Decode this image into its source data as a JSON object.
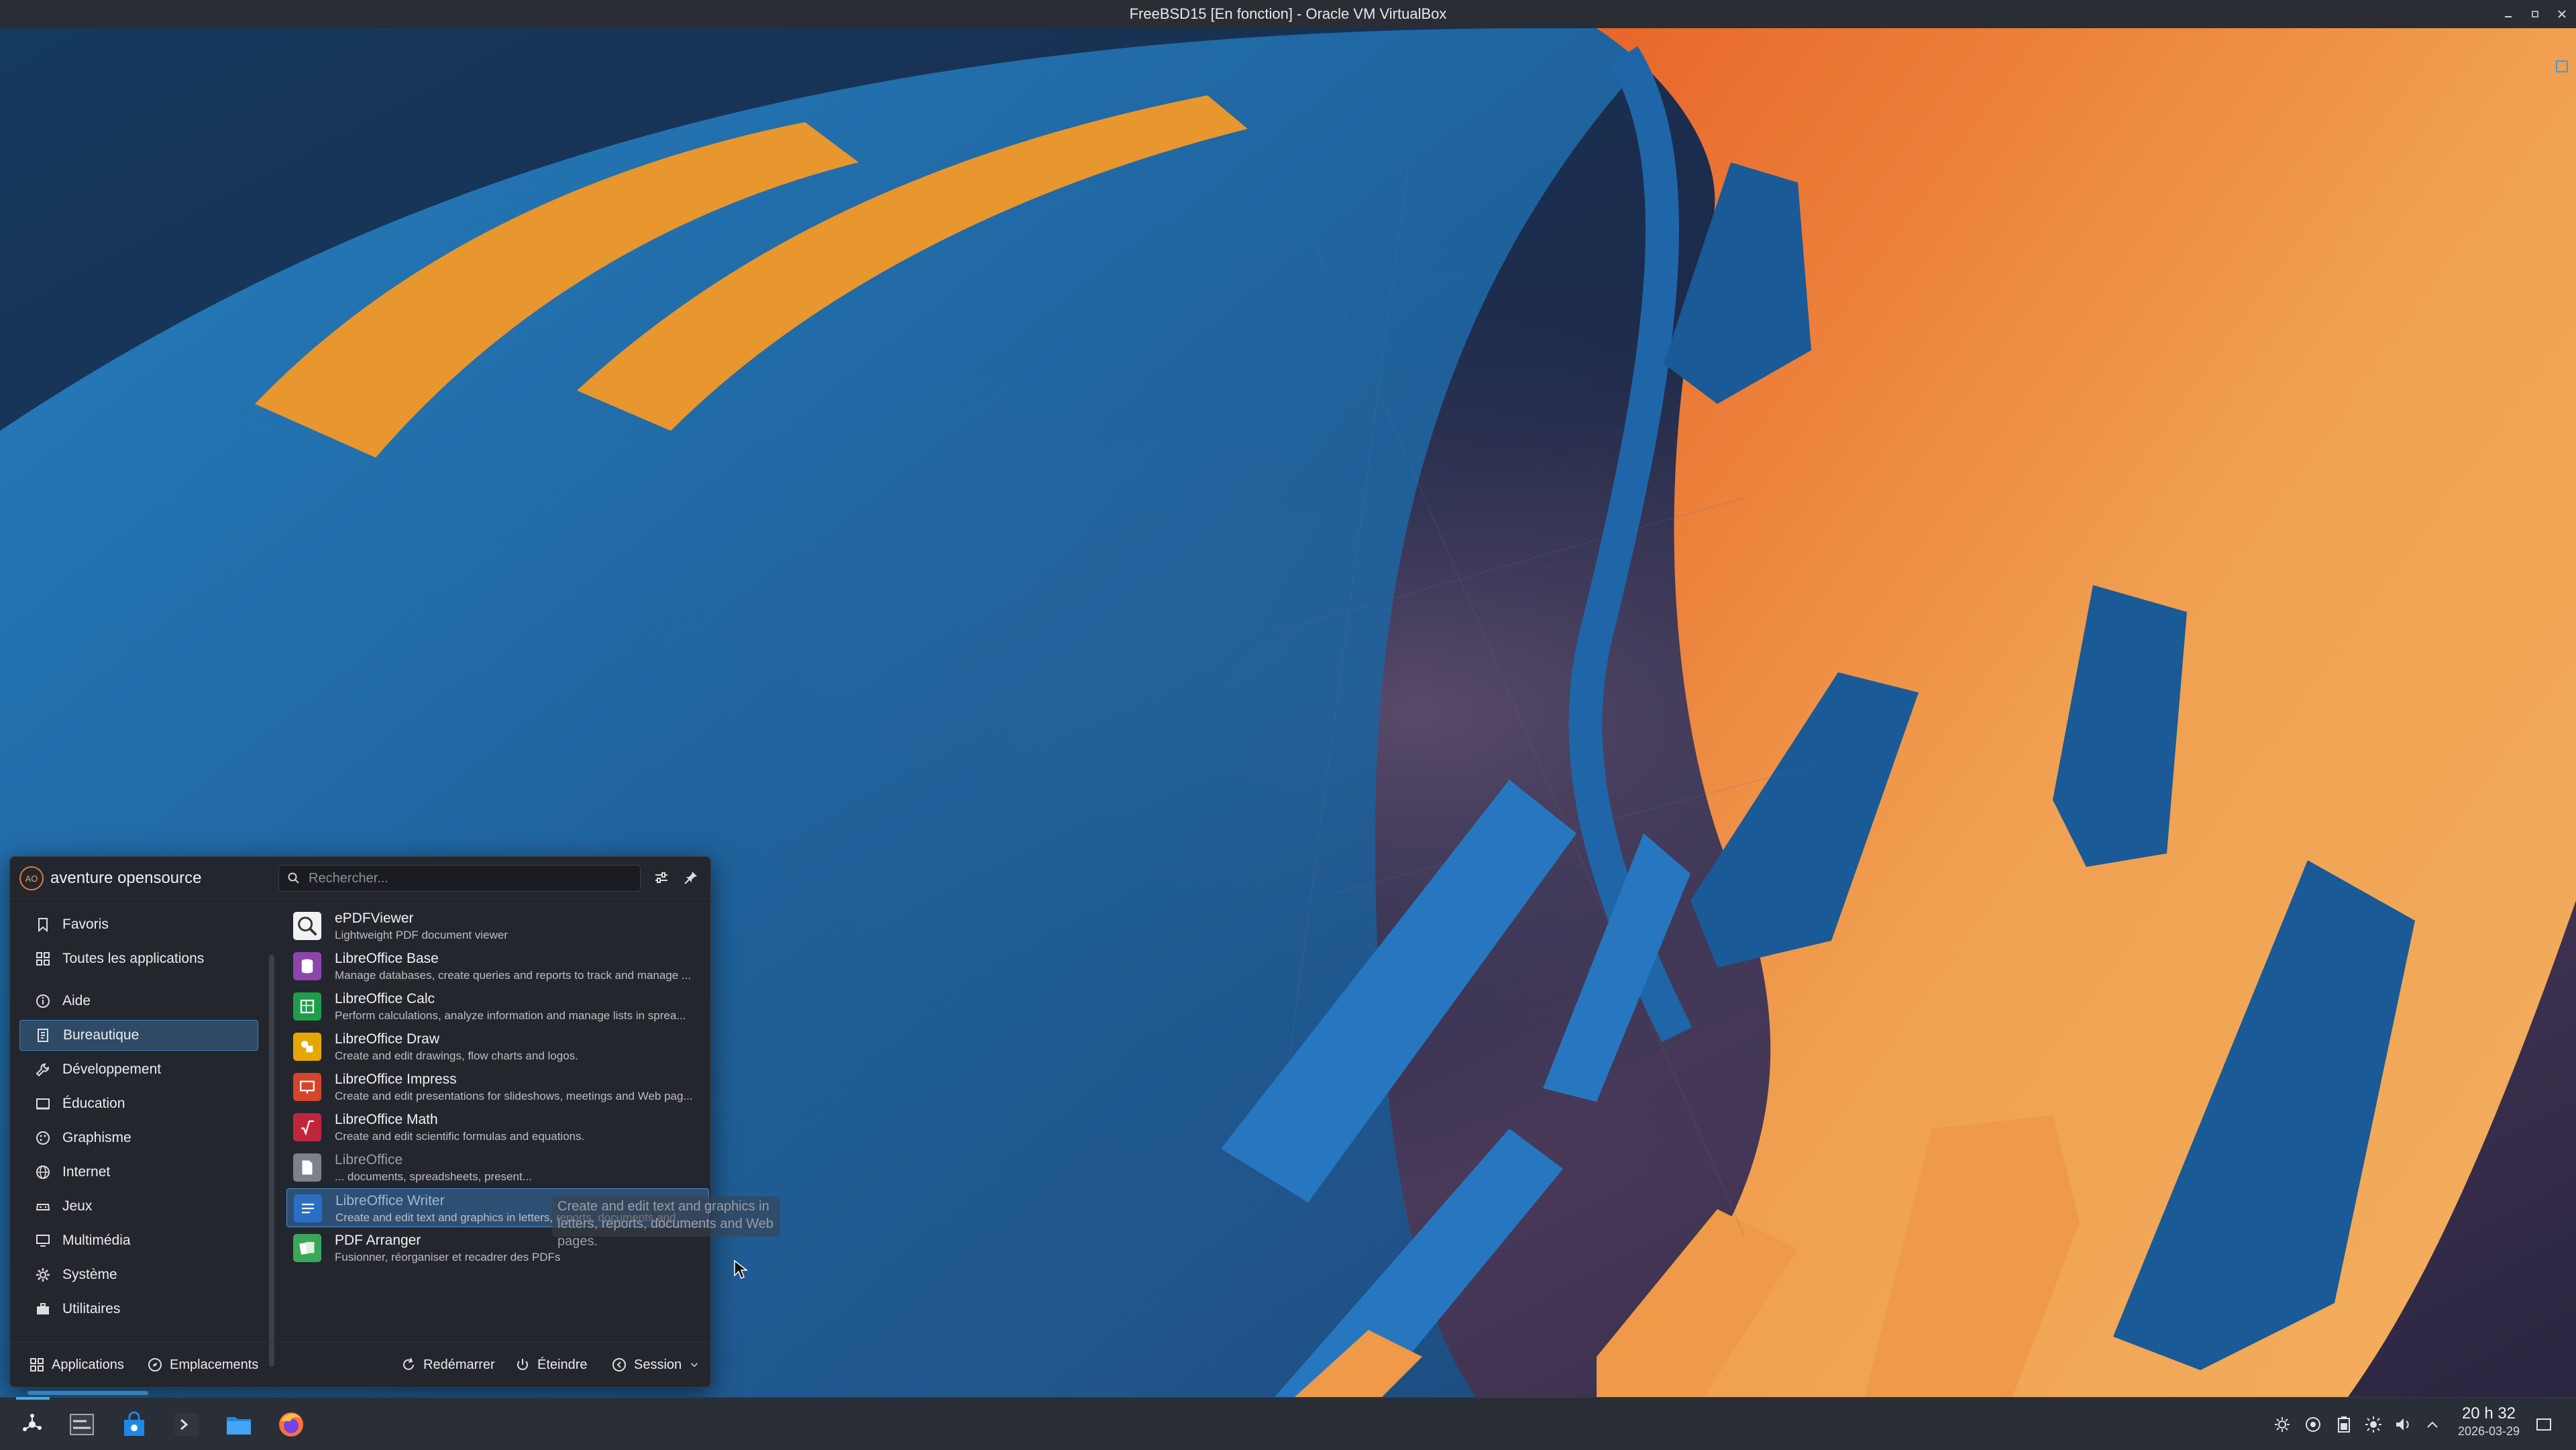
{
  "window": {
    "title": "FreeBSD15 [En fonction] - Oracle VM VirtualBox",
    "controls": [
      "minimize-icon",
      "restore-icon",
      "close-icon"
    ]
  },
  "launcher": {
    "user": {
      "initials": "AO",
      "name": "aventure opensource"
    },
    "search": {
      "placeholder": "Rechercher...",
      "value": ""
    },
    "header_buttons": [
      "configure-icon",
      "pin-icon"
    ],
    "categories": [
      {
        "label": "Favoris",
        "icon": "bookmark-icon",
        "selected": false
      },
      {
        "label": "Toutes les applications",
        "icon": "grid-icon",
        "selected": false
      },
      {
        "label": "Aide",
        "icon": "info-icon",
        "selected": false
      },
      {
        "label": "Bureautique",
        "icon": "office-icon",
        "selected": true
      },
      {
        "label": "Développement",
        "icon": "wrench-icon",
        "selected": false
      },
      {
        "label": "Éducation",
        "icon": "education-icon",
        "selected": false
      },
      {
        "label": "Graphisme",
        "icon": "palette-icon",
        "selected": false
      },
      {
        "label": "Internet",
        "icon": "globe-icon",
        "selected": false
      },
      {
        "label": "Jeux",
        "icon": "gamepad-icon",
        "selected": false
      },
      {
        "label": "Multimédia",
        "icon": "monitor-icon",
        "selected": false
      },
      {
        "label": "Système",
        "icon": "gear-icon",
        "selected": false
      },
      {
        "label": "Utilitaires",
        "icon": "toolbox-icon",
        "selected": false
      }
    ],
    "apps": [
      {
        "name": "ePDFViewer",
        "desc": "Lightweight PDF document viewer",
        "icon": "pdf-viewer-icon",
        "color": "#e6e6e6"
      },
      {
        "name": "LibreOffice Base",
        "desc": "Manage databases, create queries and reports to track and manage ...",
        "icon": "libreoffice-base-icon",
        "color": "#8e44ad"
      },
      {
        "name": "LibreOffice Calc",
        "desc": "Perform calculations, analyze information and manage lists in sprea...",
        "icon": "libreoffice-calc-icon",
        "color": "#1e9e4a"
      },
      {
        "name": "LibreOffice Draw",
        "desc": "Create and edit drawings, flow charts and logos.",
        "icon": "libreoffice-draw-icon",
        "color": "#e6a800"
      },
      {
        "name": "LibreOffice Impress",
        "desc": "Create and edit presentations for slideshows, meetings and Web pag...",
        "icon": "libreoffice-impress-icon",
        "color": "#d4452a"
      },
      {
        "name": "LibreOffice Math",
        "desc": "Create and edit scientific formulas and equations.",
        "icon": "libreoffice-math-icon",
        "color": "#c0263a"
      },
      {
        "name": "LibreOffice",
        "desc": "... documents, spreadsheets, present...",
        "icon": "libreoffice-icon",
        "color": "#9aa0a8"
      },
      {
        "name": "LibreOffice Writer",
        "desc": "Create and edit text and graphics in letters, reports, documents and ...",
        "icon": "libreoffice-writer-icon",
        "color": "#2a6fc4",
        "highlighted": true
      },
      {
        "name": "PDF Arranger",
        "desc": "Fusionner, réorganiser et recadrer des PDFs",
        "icon": "pdf-arranger-icon",
        "color": "#3aa657"
      }
    ],
    "tooltip": "Create and edit text and graphics in letters, reports, documents and Web pages.",
    "footer": {
      "applications": "Applications",
      "places": "Emplacements",
      "restart": "Redémarrer",
      "shutdown": "Éteindre",
      "session": "Session"
    }
  },
  "taskbar": {
    "pinned": [
      "application-launcher-icon",
      "pager-icon",
      "discover-store-icon",
      "terminal-icon",
      "file-manager-icon",
      "firefox-icon"
    ],
    "tray": [
      "network-icon",
      "clipboard-icon",
      "battery-icon",
      "brightness-icon",
      "volume-icon",
      "chevron-up-icon"
    ],
    "clock": {
      "time": "20 h 32",
      "date": "2026-03-29"
    },
    "show_desktop": "show-desktop-icon"
  },
  "colors": {
    "accent": "#3daee9",
    "selection": "#2d4f74",
    "panel": "#2a2e36",
    "wallpaper_orange": "#f0a050",
    "wallpaper_blue": "#1e6aa8"
  }
}
